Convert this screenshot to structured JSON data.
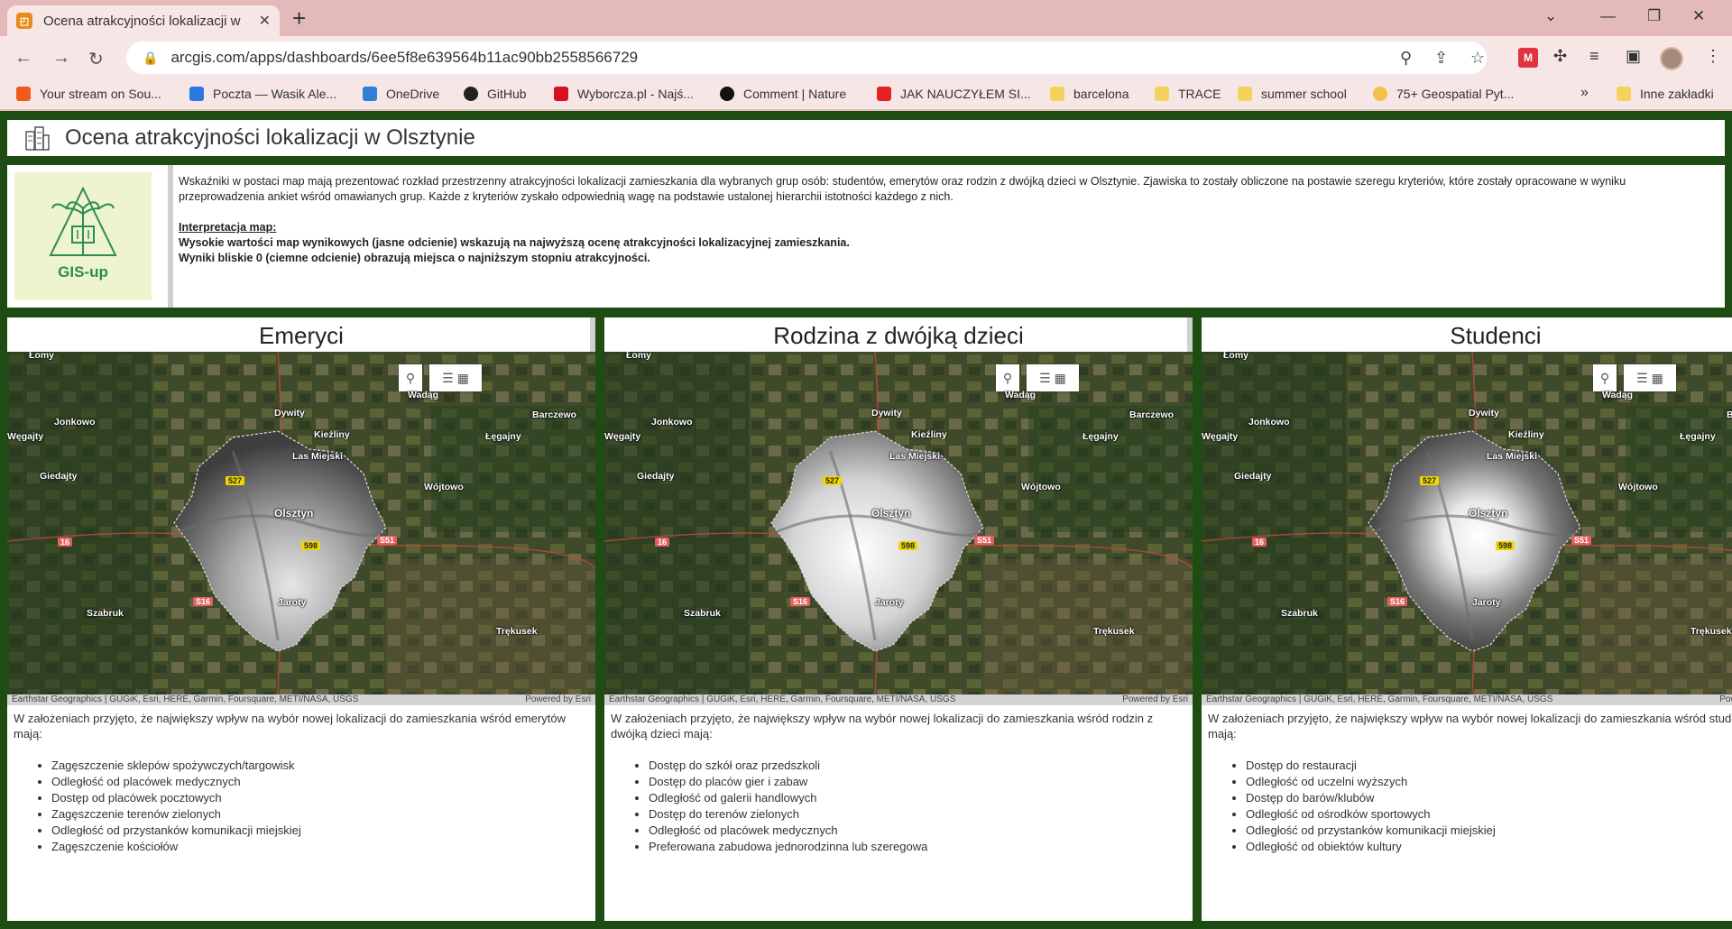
{
  "browser": {
    "tab_title": "Ocena atrakcyjności lokalizacji w",
    "tab_close": "✕",
    "new_tab": "+",
    "url": "arcgis.com/apps/dashboards/6ee5f8e639564b11ac90bb2558566729",
    "bookmarks": [
      {
        "label": "Your stream on Sou...",
        "color": "#f05a1a"
      },
      {
        "label": "Poczta — Wasik Ale...",
        "color": "#2a7ae2"
      },
      {
        "label": "OneDrive",
        "color": "#2f7fd8"
      },
      {
        "label": "GitHub",
        "color": "#222222"
      },
      {
        "label": "Wyborcza.pl - Najś...",
        "color": "#d6111d"
      },
      {
        "label": "Comment | Nature",
        "color": "#111111"
      },
      {
        "label": "JAK NAUCZYŁEM SI...",
        "color": "#e52222"
      },
      {
        "label": "barcelona",
        "color": "#f3d35b"
      },
      {
        "label": "TRACE",
        "color": "#f3d35b"
      },
      {
        "label": "summer school",
        "color": "#f3d35b"
      },
      {
        "label": "75+ Geospatial Pyt...",
        "color": "#f3c04a"
      }
    ],
    "bookmarks_more": "»",
    "other_bookmarks": "Inne zakładki"
  },
  "dashboard": {
    "title": "Ocena atrakcyjności lokalizacji w Olsztynie",
    "logo_text": "GIS-up",
    "intro": "Wskaźniki w postaci map mają prezentować rozkład przestrzenny atrakcyjności lokalizacji zamieszkania dla wybranych grup osób: studentów, emerytów oraz rodzin z dwójką dzieci w Olsztynie. Zjawiska to zostały obliczone na postawie szeregu kryteriów, które zostały opracowane w wyniku przeprowadzenia ankiet wśród omawianych grup. Każde z kryteriów zyskało odpowiednią wagę na podstawie ustalonej hierarchii istotności każdego z nich.",
    "interp_heading": "Interpretacja map:",
    "interp_line1": "Wysokie wartości map wynikowych (jasne odcienie) wskazują na najwyższą ocenę atrakcyjności lokalizacyjnej zamieszkania.",
    "interp_line2": "Wyniki bliskie 0 (ciemne odcienie) obrazują miejsca o najniższym stopniu atrakcyjności."
  },
  "map_common": {
    "attribution": "Earthstar Geographics | GUGiK, Esri, HERE, Garmin, Foursquare, METI/NASA, USGS",
    "powered": "Powered by Esri",
    "places": {
      "lomy": "Łomy",
      "jonkowo": "Jonkowo",
      "wegajty": "Węgajty",
      "giedajty": "Giedajty",
      "dywity": "Dywity",
      "wadag": "Wadąg",
      "barczewo": "Barczewo",
      "kieźliny": "Kieźliny",
      "legajny": "Łęgajny",
      "las": "Las Miejski",
      "wojtowo": "Wójtowo",
      "olsztyn": "Olsztyn",
      "jaroty": "Jaroty",
      "szabruk": "Szabruk",
      "trekusek": "Trękusek"
    },
    "roads": {
      "r527": "527",
      "r598": "598",
      "r16": "16",
      "s51": "S51",
      "s16": "S16"
    }
  },
  "panels": [
    {
      "title": "Emeryci",
      "intro": "W założeniach przyjęto, że największy wpływ na wybór nowej lokalizacji do zamieszkania wśród emerytów mają:",
      "items": [
        "Zagęszczenie sklepów spożywczych/targowisk",
        "Odległość od placówek medycznych",
        "Dostęp od placówek pocztowych",
        "Zagęszczenie terenów zielonych",
        "Odległość od przystanków komunikacji miejskiej",
        "Zagęszczenie kościołów"
      ]
    },
    {
      "title": "Rodzina z dwójką dzieci",
      "intro": "W założeniach przyjęto, że największy wpływ na wybór nowej lokalizacji do zamieszkania wśród rodzin z dwójką dzieci mają:",
      "items": [
        "Dostęp do szkół oraz przedszkoli",
        "Dostęp do placów gier i zabaw",
        "Odległość od galerii handlowych",
        "Dostęp do terenów zielonych",
        "Odległość od placówek medycznych",
        "Preferowana zabudowa jednorodzinna lub szeregowa"
      ]
    },
    {
      "title": "Studenci",
      "intro": "W założeniach przyjęto, że największy wpływ na wybór nowej lokalizacji do zamieszkania wśród studentów mają:",
      "items": [
        "Dostęp do restauracji",
        "Odległość od uczelni wyższych",
        "Dostęp do barów/klubów",
        "Odległość od ośrodków sportowych",
        "Odległość od przystanków komunikacji miejskiej",
        "Odległość od obiektów kultury"
      ]
    }
  ],
  "colors": {
    "frame": "#1e4d13",
    "chrome": "#e3b9b9",
    "logo_bg": "#eef4cd",
    "logo_green": "#2e8a57"
  }
}
